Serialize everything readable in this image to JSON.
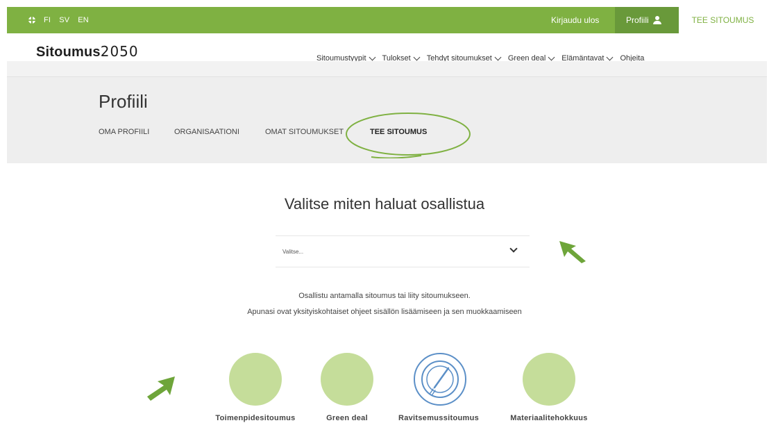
{
  "topbar": {
    "languages": [
      "FI",
      "SV",
      "EN"
    ],
    "logout": "Kirjaudu ulos",
    "profile": "Profiili",
    "tee_sitoumus": "TEE SITOUMUS"
  },
  "logo": {
    "word": "Sitoumus",
    "number": "2050"
  },
  "nav": {
    "items": [
      "Sitoumustyypit",
      "Tulokset",
      "Tehdyt sitoumukset",
      "Green deal",
      "Elämäntavat",
      "Ohjeita"
    ]
  },
  "profile": {
    "title": "Profiili",
    "tabs": [
      "OMA PROFIILI",
      "ORGANISAATIONI",
      "OMAT SITOUMUKSET",
      "TEE SITOUMUS"
    ]
  },
  "main": {
    "heading": "Valitse miten haluat osallistua",
    "select_placeholder": "Valitse...",
    "info_line1": "Osallistu antamalla sitoumus tai liity sitoumukseen.",
    "info_line2": "Apunasi ovat yksityiskohtaiset ohjeet sisällön lisäämiseen ja sen muokkaamiseen"
  },
  "cards": [
    "Toimenpidesitoumus",
    "Green deal",
    "Ravitsemussitoumus",
    "Materiaalitehokkuus"
  ],
  "colors": {
    "brand_green": "#7fb142",
    "card_green": "#c5dd9a",
    "plate_blue": "#5b8fc7",
    "band_gray": "#eeeeee"
  },
  "icons": {
    "globe": "globe-icon",
    "user": "user-icon",
    "chevron": "chevron-down-icon",
    "plate": "plate-fork-icon",
    "arrow": "arrow-annotation"
  }
}
